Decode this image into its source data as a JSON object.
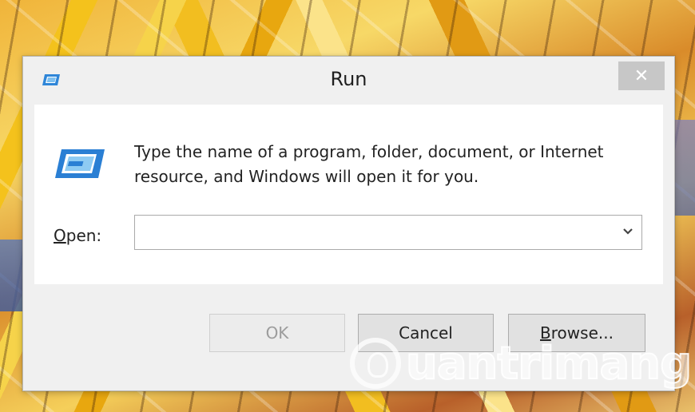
{
  "window": {
    "title": "Run",
    "close_glyph": "✕",
    "description": "Type the name of a program, folder, document, or Internet resource, and Windows will open it for you.",
    "open_label_underlined": "O",
    "open_label_rest": "pen:",
    "open_value": "",
    "buttons": {
      "ok": "OK",
      "cancel": "Cancel",
      "browse_underlined": "B",
      "browse_rest": "rowse..."
    }
  },
  "watermark": {
    "text": "uantrimang"
  },
  "icons": {
    "title": "run-program-icon",
    "main": "run-program-icon",
    "dropdown": "chevron-down-icon"
  },
  "colors": {
    "window_bg": "#f0f0f0",
    "content_bg": "#ffffff",
    "close_bg": "#c7c7c7",
    "icon_blue": "#2a7fd4"
  }
}
